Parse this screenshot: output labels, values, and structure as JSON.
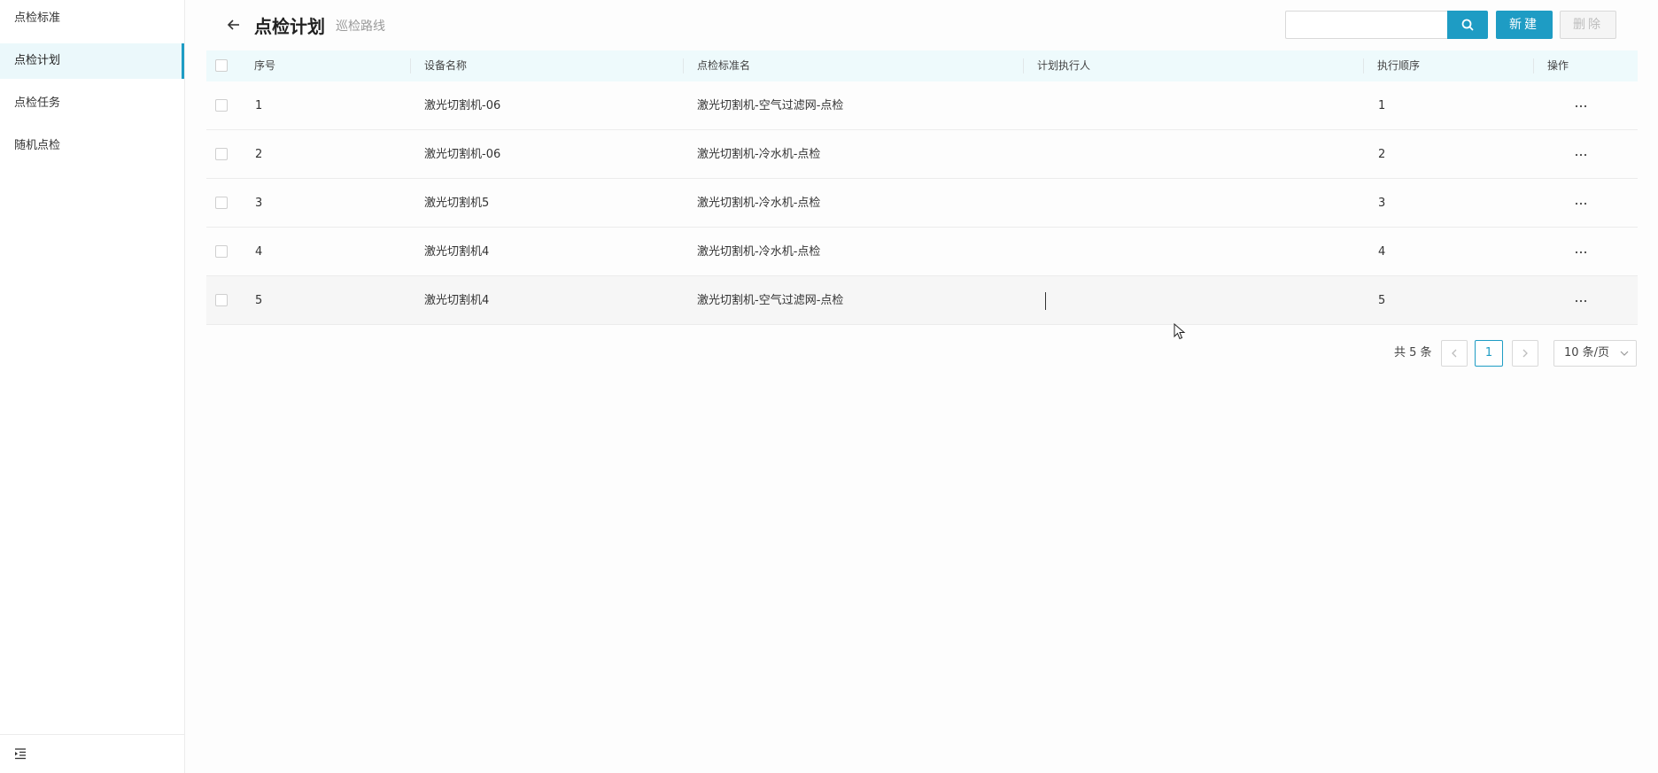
{
  "sidebar": {
    "items": [
      {
        "label": "点检标准"
      },
      {
        "label": "点检计划"
      },
      {
        "label": "点检任务"
      },
      {
        "label": "随机点检"
      }
    ]
  },
  "header": {
    "title": "点检计划",
    "subtitle": "巡检路线",
    "search_placeholder": "",
    "new_label": "新建",
    "delete_label": "删除"
  },
  "table": {
    "columns": [
      "序号",
      "设备名称",
      "点检标准名",
      "计划执行人",
      "执行顺序",
      "操作"
    ],
    "rows": [
      {
        "index": "1",
        "device": "激光切割机-06",
        "standard": "激光切割机-空气过滤网-点检",
        "executor": "",
        "order": "1"
      },
      {
        "index": "2",
        "device": "激光切割机-06",
        "standard": "激光切割机-冷水机-点检",
        "executor": "",
        "order": "2"
      },
      {
        "index": "3",
        "device": "激光切割机5",
        "standard": "激光切割机-冷水机-点检",
        "executor": "",
        "order": "3"
      },
      {
        "index": "4",
        "device": "激光切割机4",
        "standard": "激光切割机-冷水机-点检",
        "executor": "",
        "order": "4"
      },
      {
        "index": "5",
        "device": "激光切割机4",
        "standard": "激光切割机-空气过滤网-点检",
        "executor": "",
        "order": "5"
      }
    ]
  },
  "pagination": {
    "total": "共 5 条",
    "current_page": "1",
    "page_size": "10 条/页"
  },
  "colors": {
    "accent": "#1e9cc4",
    "header_bg": "#eefafc",
    "active_nav_bg": "#ebf8fb"
  },
  "icons": [
    "back-arrow-icon",
    "search-icon",
    "more-icon",
    "collapse-menu-icon",
    "chevron-left-icon",
    "chevron-right-icon",
    "chevron-down-icon",
    "mouse-cursor-icon"
  ]
}
